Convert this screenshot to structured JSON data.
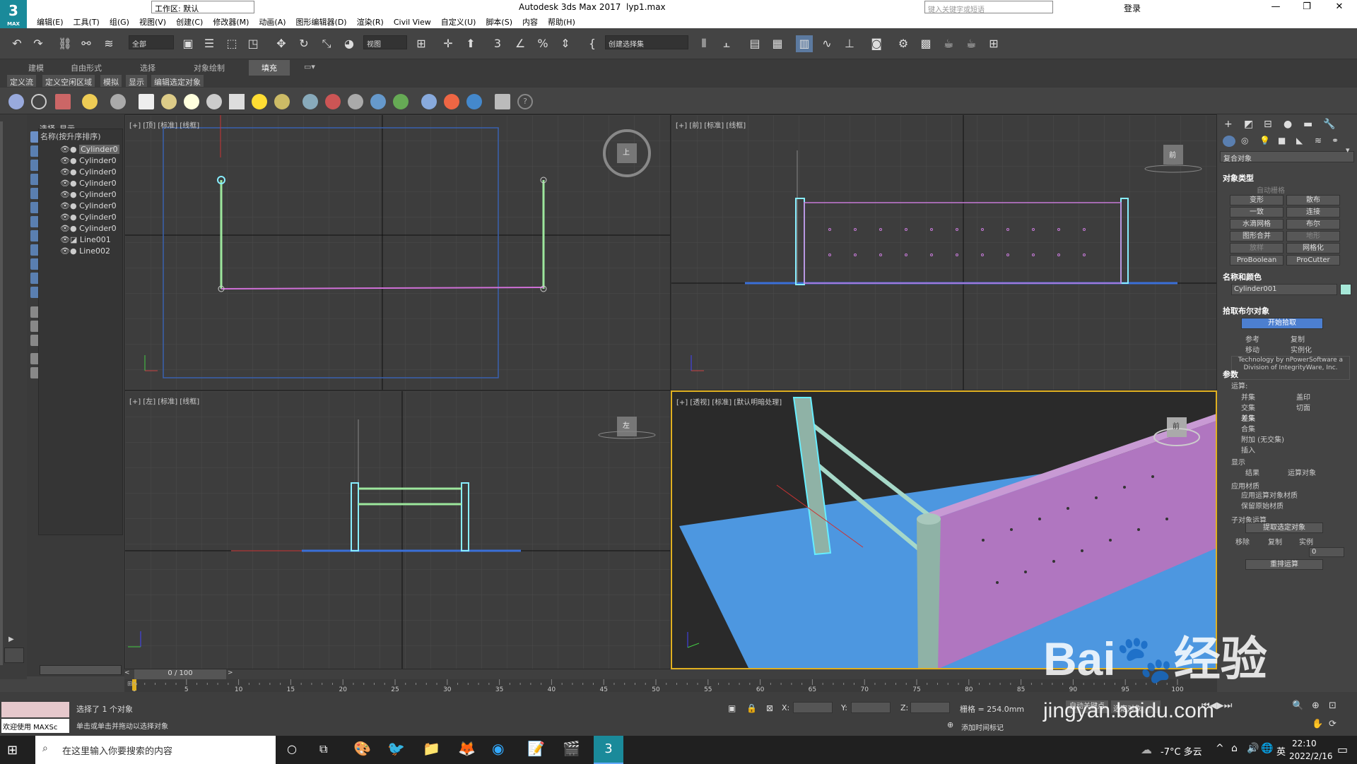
{
  "app": {
    "title": "Autodesk 3ds Max 2017",
    "file": "lyp1.max",
    "logo": "3",
    "logo_sub": "MAX",
    "workspace": "工作区: 默认",
    "search_placeholder": "键入关键字或短语",
    "login": "登录"
  },
  "menu": [
    "编辑(E)",
    "工具(T)",
    "组(G)",
    "视图(V)",
    "创建(C)",
    "修改器(M)",
    "动画(A)",
    "图形编辑器(D)",
    "渲染(R)",
    "Civil View",
    "自定义(U)",
    "脚本(S)",
    "内容",
    "帮助(H)"
  ],
  "toolbar": {
    "filter": "全部",
    "view": "视图",
    "selection_set": "创建选择集"
  },
  "ribbon": {
    "tabs": [
      "建模",
      "自由形式",
      "选择",
      "对象绘制",
      "填充"
    ],
    "active_tab": "填充",
    "subtabs": [
      "定义流",
      "定义空闲区域",
      "模拟",
      "显示",
      "编辑选定对象"
    ]
  },
  "scene_explorer": {
    "tabs": [
      "选择",
      "显示"
    ],
    "header": "名称(按升序排序)",
    "items": [
      "Cylinder0",
      "Cylinder0",
      "Cylinder0",
      "Cylinder0",
      "Cylinder0",
      "Cylinder0",
      "Cylinder0",
      "Cylinder0",
      "Line001",
      "Line002"
    ]
  },
  "viewports": {
    "top": "[+] [顶] [标准] [线框]",
    "front": "[+] [前] [标准] [线框]",
    "left": "[+] [左] [标准] [线框]",
    "persp": "[+] [透视] [标准] [默认明暗处理]",
    "cube_top": "上",
    "cube_front": "前",
    "cube_left": "左",
    "cube_persp": "前"
  },
  "command_panel": {
    "category": "复合对象",
    "rollout_object_type": "对象类型",
    "autogrid": "自动栅格",
    "buttons": [
      "变形",
      "散布",
      "一致",
      "连接",
      "水滴网格",
      "布尔",
      "图形合并",
      "地形",
      "放样",
      "网格化",
      "ProBoolean",
      "ProCutter"
    ],
    "rollout_name_color": "名称和颜色",
    "object_name": "Cylinder001",
    "object_color": "#a6e8d8",
    "rollout_pick": "拾取布尔对象",
    "pick_button": "开始拾取",
    "pick_options": [
      "参考",
      "复制",
      "移动",
      "实例化"
    ],
    "tech_note": "Technology by nPowerSoftware a Division of IntegrityWare, Inc.",
    "rollout_params": "参数",
    "operations_label": "运算:",
    "operations": [
      "并集",
      "交集",
      "差集",
      "合集",
      "附加 (无交集)",
      "插入"
    ],
    "ops_right": [
      "盖印",
      "切面"
    ],
    "display_label": "显示",
    "display_opts": [
      "结果",
      "运算对象"
    ],
    "material_label": "应用材质",
    "material_opts": [
      "应用运算对象材质",
      "保留原始材质"
    ],
    "subobj_label": "子对象运算",
    "subobj_btn": "提取选定对象",
    "subobj_opts": [
      "移除",
      "复制",
      "实例"
    ],
    "copy_num": "0",
    "reorder": "重排运算"
  },
  "timeline": {
    "frame": "0 / 100",
    "ticks": [
      "0",
      "5",
      "10",
      "15",
      "20",
      "25",
      "30",
      "35",
      "40",
      "45",
      "50",
      "55",
      "60",
      "65",
      "70",
      "75",
      "80",
      "85",
      "90",
      "95",
      "100"
    ]
  },
  "status": {
    "welcome": "欢迎使用 MAXSc",
    "selected": "选择了 1 个对象",
    "hint": "单击或单击并拖动以选择对象",
    "x_label": "X:",
    "y_label": "Y:",
    "z_label": "Z:",
    "grid": "栅格 = 254.0mm",
    "add_tag": "添加时间标记",
    "autokey": "自动关键点",
    "setkey": "选定对象"
  },
  "taskbar": {
    "search": "在这里输入你要搜索的内容",
    "weather": "-7°C 多云",
    "lang": "英",
    "time": "22:10",
    "date": "2022/2/16"
  },
  "watermark": "jingyan.baidu.com"
}
